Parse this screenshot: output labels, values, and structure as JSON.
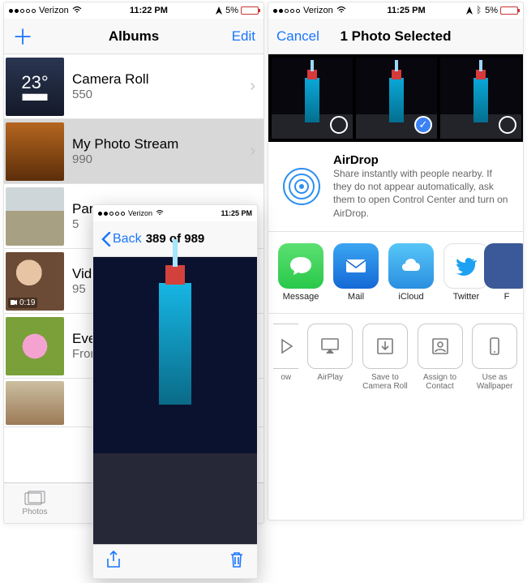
{
  "phone1": {
    "status": {
      "carrier": "Verizon",
      "time": "11:22 PM",
      "battery": "5%"
    },
    "nav": {
      "title": "Albums",
      "edit": "Edit"
    },
    "albums": [
      {
        "name": "Camera Roll",
        "count": "550",
        "thumb": "weather",
        "temp": "23°"
      },
      {
        "name": "My Photo Stream",
        "count": "990",
        "thumb": "room"
      },
      {
        "name": "Par",
        "count": "5",
        "thumb": "land"
      },
      {
        "name": "Vid",
        "count": "95",
        "thumb": "face",
        "video_badge": "0:19"
      },
      {
        "name": "Eve",
        "count": "Fron",
        "thumb": "flower"
      }
    ],
    "tab": "Photos"
  },
  "phone2": {
    "status": {
      "carrier": "Verizon",
      "time": "11:25 PM",
      "battery": "5%"
    },
    "nav": {
      "cancel": "Cancel",
      "title": "1 Photo Selected"
    },
    "airdrop": {
      "title": "AirDrop",
      "desc": "Share instantly with people nearby. If they do not appear automatically, ask them to open Control Center and turn on AirDrop."
    },
    "share": [
      {
        "label": "Message"
      },
      {
        "label": "Mail"
      },
      {
        "label": "iCloud"
      },
      {
        "label": "Twitter"
      },
      {
        "label": "F"
      }
    ],
    "actions": [
      {
        "label": "ow"
      },
      {
        "label": "AirPlay"
      },
      {
        "label": "Save to Camera Roll"
      },
      {
        "label": "Assign to Contact"
      },
      {
        "label": "Use as Wallpaper"
      }
    ]
  },
  "phone3": {
    "status": {
      "carrier": "Verizon",
      "time": "11:25 PM"
    },
    "nav": {
      "back": "Back",
      "title": "389 of 989"
    }
  }
}
